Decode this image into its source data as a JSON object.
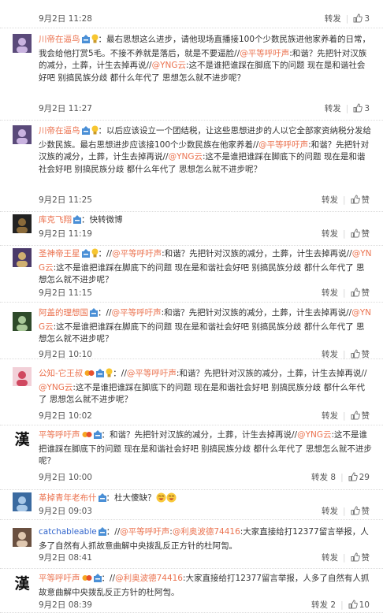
{
  "labels": {
    "repost": "转发",
    "like": "赞"
  },
  "comments": [
    {
      "user": "",
      "prefix": "",
      "text": "会好吧 别搞民族分歧 都什么年代了 思想怎么就不进步呢？",
      "time": "9月2日 11:28",
      "repost_count": "",
      "like_count": "3"
    },
    {
      "user": "川帝在逼鸟",
      "prefix": "：最右思想这么进步，请他现场直播接100个少数民族进他家养着的日常，我会给他打赏5毛。不接不养就是落后，就是不要逼脸//",
      "mention1": "@平等呼吁声",
      "mid1": ":和谐？先把针对汉族的减分，土葬，计生去掉再说//",
      "mention2": "@YNG云",
      "tail": ":这不是谁把谁踩在脚底下的问题 现在是和谐社会好吧 别搞民族分歧 都什么年代了 思想怎么就不进步呢？",
      "time": "9月2日 11:27",
      "repost_count": "",
      "like_count": "3"
    },
    {
      "user": "川帝在逼鸟",
      "prefix": "：以后应该设立一个团结税，让这些思想进步的人以它全部家资纳税分发给少数民族。最右思想进步应该接100个少数民族在他家养着//",
      "mention1": "@平等呼吁声",
      "mid1": ":和谐？先把针对汉族的减分，土葬，计生去掉再说//",
      "mention2": "@YNG云",
      "tail": ":这不是谁把谁踩在脚底下的问题 现在是和谐社会好吧 别搞民族分歧 都什么年代了 思想怎么就不进步呢？",
      "time": "9月2日 11:25",
      "repost_count": "",
      "like_count": ""
    },
    {
      "user": "库克飞翔",
      "prefix": "：快转微博",
      "time": "9月2日 11:19",
      "repost_count": "",
      "like_count": ""
    },
    {
      "user": "圣神帝王星",
      "prefix": "：//",
      "mention1": "@平等呼吁声",
      "mid1": ":和谐？先把针对汉族的减分，土葬，计生去掉再说//",
      "mention2": "@YNG云",
      "tail": ":这不是谁把谁踩在脚底下的问题 现在是和谐社会好吧 别搞民族分歧 都什么年代了 思想怎么就不进步呢？",
      "time": "9月2日 11:15",
      "repost_count": "",
      "like_count": ""
    },
    {
      "user": "阿盖的理想国",
      "prefix": "：//",
      "mention1": "@平等呼吁声",
      "mid1": ":和谐？先把针对汉族的减分，土葬，计生去掉再说//",
      "mention2": "@YNG云",
      "tail": ":这不是谁把谁踩在脚底下的问题 现在是和谐社会好吧 别搞民族分歧 都什么年代了 思想怎么就不进步呢？",
      "time": "9月2日 10:10",
      "repost_count": "",
      "like_count": ""
    },
    {
      "user": "公知-它王叔",
      "prefix": "：//",
      "mention1": "@平等呼吁声",
      "mid1": ":和谐？先把针对汉族的减分，土葬，计生去掉再说//",
      "mention2": "@YNG云",
      "tail": ":这不是谁把谁踩在脚底下的问题 现在是和谐社会好吧 别搞民族分歧 都什么年代了 思想怎么就不进步呢？",
      "time": "9月2日 10:02",
      "repost_count": "",
      "like_count": ""
    },
    {
      "user": "平等呼吁声",
      "prefix": "：和谐？先把针对汉族的减分，土葬，计生去掉再说//",
      "mention1": "@YNG云",
      "tail": ":这不是谁把谁踩在脚底下的问题 现在是和谐社会好吧 别搞民族分歧 都什么年代了 思想怎么就不进步呢？",
      "time": "9月2日 10:00",
      "repost_count": "8",
      "like_count": "29"
    },
    {
      "user": "革掉青年老布什",
      "prefix": "：杜大傻缺？",
      "time": "9月2日 09:03",
      "repost_count": "",
      "like_count": ""
    },
    {
      "user": "catchableable",
      "prefix": "：//",
      "mention1": "@平等呼吁声",
      "mid1": ":",
      "mention2": "@利奥波德74416",
      "tail": ":大家直接给打12377留言举报，人多了自然有人抓故意曲解中央拨乱反正方针的杜阿訇。",
      "time": "9月2日 08:41",
      "repost_count": "",
      "like_count": ""
    },
    {
      "user": "平等呼吁声",
      "prefix": "：//",
      "mention1": "@利奥波德74416",
      "tail": ":大家直接给打12377留言举报，人多了自然有人抓故意曲解中央拨乱反正方针的杜阿訇。",
      "time": "9月2日 08:39",
      "repost_count": "2",
      "like_count": "10"
    }
  ]
}
